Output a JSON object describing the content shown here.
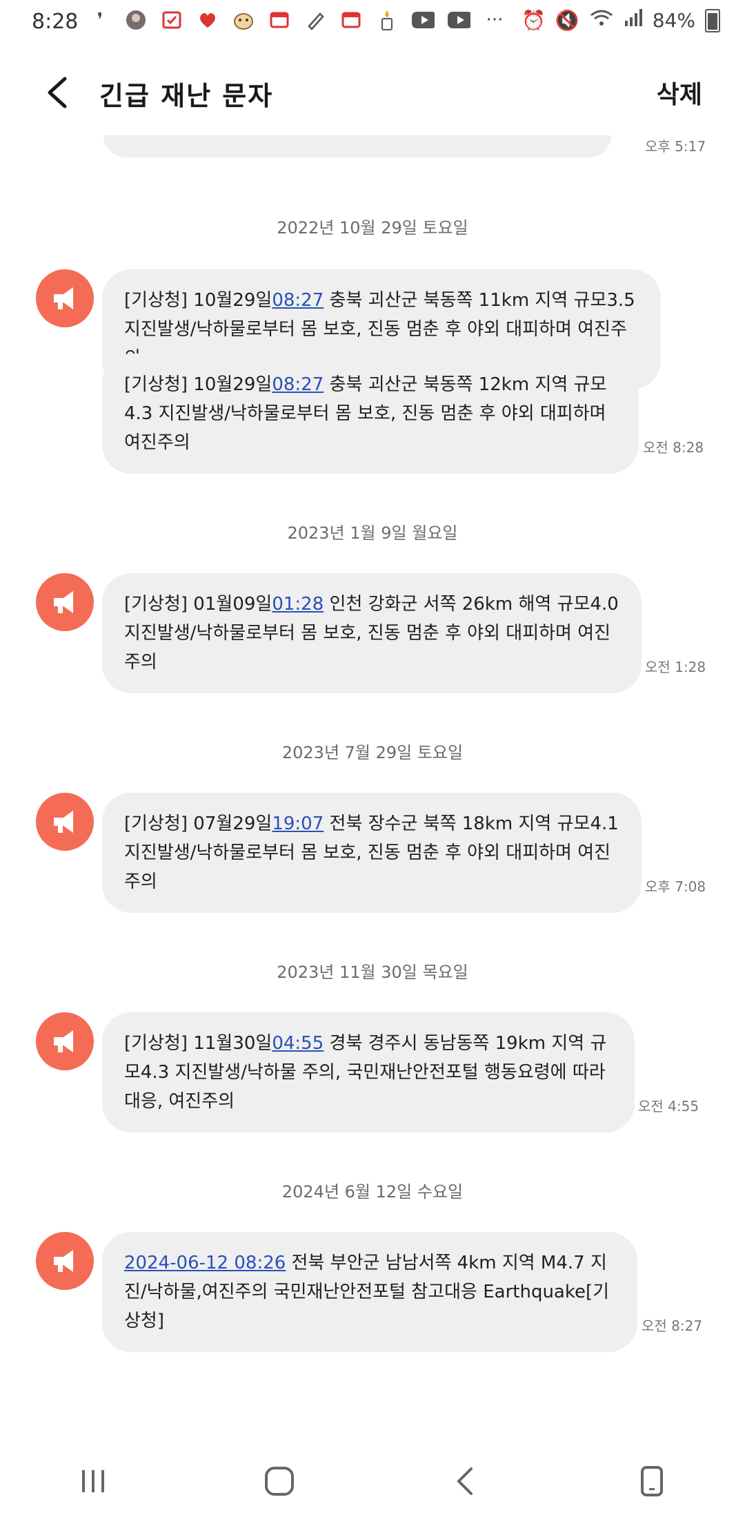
{
  "status": {
    "time": "8:28",
    "battery_text": "84%"
  },
  "header": {
    "title": "긴급 재난 문자",
    "delete_label": "삭제"
  },
  "top_fragment_time": "오후 5:17",
  "groups": [
    {
      "date": "2022년 10월 29일 토요일",
      "messages": [
        {
          "prefix": "[기상청] 10월29일",
          "link": "08:27",
          "rest": " 충북 괴산군 북동쪽 11km 지역 규모3.5 지진발생/낙하물로부터 몸 보호, 진동 멈춘 후 야외 대피하며 여진주의"
        },
        {
          "prefix": "[기상청] 10월29일",
          "link": "08:27",
          "rest": " 충북 괴산군 북동쪽 12km 지역 규모4.3 지진발생/낙하물로부터 몸 보호, 진동 멈춘 후 야외 대피하며 여진주의"
        }
      ],
      "time": "오전 8:28"
    },
    {
      "date": "2023년 1월 9일 월요일",
      "messages": [
        {
          "prefix": "[기상청] 01월09일",
          "link": "01:28",
          "rest": " 인천 강화군 서쪽 26km 해역 규모4.0 지진발생/낙하물로부터 몸 보호, 진동 멈춘 후 야외 대피하며 여진주의"
        }
      ],
      "time": "오전 1:28"
    },
    {
      "date": "2023년 7월 29일 토요일",
      "messages": [
        {
          "prefix": "[기상청] 07월29일",
          "link": "19:07",
          "rest": " 전북 장수군 북쪽 18km 지역 규모4.1 지진발생/낙하물로부터 몸 보호, 진동 멈춘 후 야외 대피하며 여진주의"
        }
      ],
      "time": "오후 7:08"
    },
    {
      "date": "2023년 11월 30일 목요일",
      "messages": [
        {
          "prefix": "[기상청] 11월30일",
          "link": "04:55",
          "rest": " 경북 경주시 동남동쪽 19km 지역 규모4.3 지진발생/낙하물 주의, 국민재난안전포털 행동요령에 따라 대응, 여진주의"
        }
      ],
      "time": "오전 4:55"
    },
    {
      "date": "2024년 6월 12일 수요일",
      "messages": [
        {
          "prefix": "",
          "link": "2024-06-12 08:26",
          "rest": " 전북 부안군 남남서쪽 4km 지역 M4.7 지진/낙하물,여진주의 국민재난안전포털 참고대응 Earthquake[기상청]"
        }
      ],
      "time": "오전 8:27"
    }
  ],
  "icons": {
    "avatar": "megaphone-icon",
    "back": "chevron-left-icon",
    "nav": [
      "recent-apps-icon",
      "home-icon",
      "back-icon",
      "tablet-icon"
    ]
  },
  "colors": {
    "avatar_bg": "#f46c55",
    "bubble_bg": "#efefef",
    "link": "#2950b8"
  }
}
